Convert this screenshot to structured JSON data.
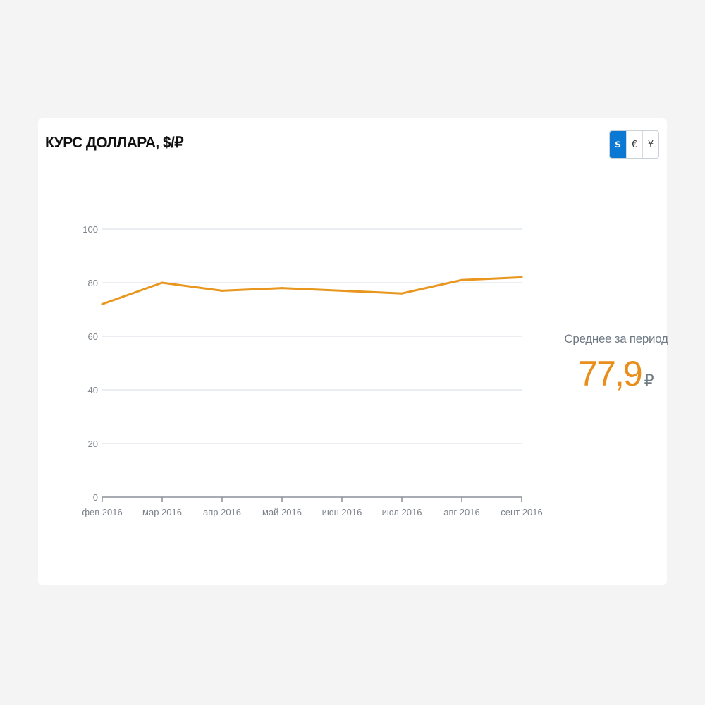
{
  "header": {
    "title": "КУРС ДОЛЛАРА, $/₽"
  },
  "currency_switch": {
    "options": [
      "$",
      "€",
      "¥"
    ],
    "selected": "$"
  },
  "summary": {
    "label": "Среднее за период",
    "value": "77,9",
    "unit": "₽"
  },
  "colors": {
    "line": "#e8961e",
    "accent": "#e98e1a",
    "active_button": "#0b78d4",
    "grid": "#e4e8ee"
  },
  "chart_data": {
    "type": "line",
    "categories": [
      "фев 2016",
      "мар 2016",
      "апр 2016",
      "май 2016",
      "июн 2016",
      "июл 2016",
      "авг 2016",
      "сент 2016"
    ],
    "series": [
      {
        "values": [
          72,
          80,
          77,
          78,
          77,
          76,
          81,
          82
        ]
      }
    ],
    "y_ticks": [
      "0",
      "20",
      "40",
      "60",
      "80",
      "100"
    ],
    "ylim": [
      0,
      100
    ],
    "grid": true,
    "legend": "none"
  }
}
